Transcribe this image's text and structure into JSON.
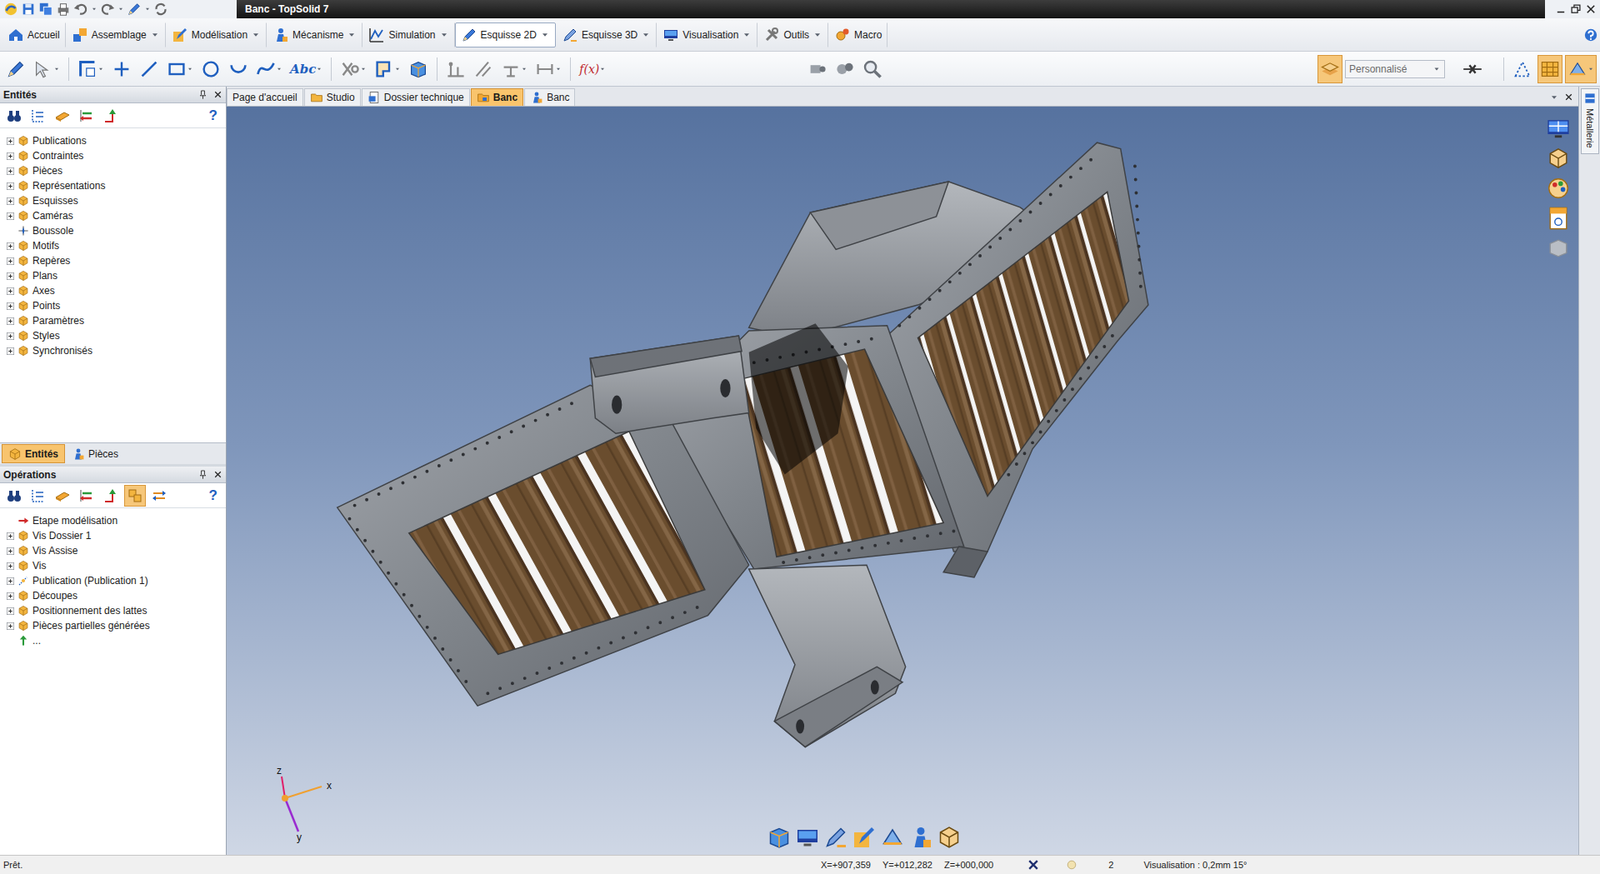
{
  "window": {
    "title": "Banc - TopSolid 7"
  },
  "ribbon_tabs": [
    {
      "label": "Accueil",
      "selected": false
    },
    {
      "label": "Assemblage",
      "selected": false
    },
    {
      "label": "Modélisation",
      "selected": false
    },
    {
      "label": "Mécanisme",
      "selected": false
    },
    {
      "label": "Simulation",
      "selected": false
    },
    {
      "label": "Esquisse 2D",
      "selected": true
    },
    {
      "label": "Esquisse 3D",
      "selected": false
    },
    {
      "label": "Visualisation",
      "selected": false
    },
    {
      "label": "Outils",
      "selected": false
    },
    {
      "label": "Macro",
      "selected": false
    }
  ],
  "toolbar": {
    "text_tool": "Abc",
    "function_tool": "f(x)",
    "style_combo": "Personnalisé",
    "style_button_on": true,
    "view_toggles": [
      {
        "on": false
      },
      {
        "on": true
      },
      {
        "on": true
      }
    ]
  },
  "entities_panel": {
    "title": "Entités",
    "help": "?",
    "items": [
      {
        "label": "Publications",
        "kind": "group",
        "expanded": false
      },
      {
        "label": "Contraintes",
        "kind": "group",
        "expanded": false
      },
      {
        "label": "Pièces",
        "kind": "group",
        "expanded": false
      },
      {
        "label": "Représentations",
        "kind": "group",
        "expanded": false
      },
      {
        "label": "Esquisses",
        "kind": "group",
        "expanded": false
      },
      {
        "label": "Caméras",
        "kind": "group",
        "expanded": false
      },
      {
        "label": "Boussole",
        "kind": "leaf"
      },
      {
        "label": "Motifs",
        "kind": "group",
        "expanded": false
      },
      {
        "label": "Repères",
        "kind": "group",
        "expanded": false
      },
      {
        "label": "Plans",
        "kind": "group",
        "expanded": false
      },
      {
        "label": "Axes",
        "kind": "group",
        "expanded": false
      },
      {
        "label": "Points",
        "kind": "group",
        "expanded": false
      },
      {
        "label": "Paramètres",
        "kind": "group",
        "expanded": false
      },
      {
        "label": "Styles",
        "kind": "group",
        "expanded": false
      },
      {
        "label": "Synchronisés",
        "kind": "group",
        "expanded": false
      }
    ]
  },
  "panel_tabs": [
    {
      "label": "Entités",
      "selected": true
    },
    {
      "label": "Pièces",
      "selected": false
    }
  ],
  "operations_panel": {
    "title": "Opérations",
    "help": "?",
    "group_toggle_on": true,
    "items": [
      {
        "label": "Etape modélisation",
        "kind": "step"
      },
      {
        "label": "Vis Dossier 1",
        "kind": "group",
        "expanded": false
      },
      {
        "label": "Vis Assise",
        "kind": "group",
        "expanded": false
      },
      {
        "label": "Vis",
        "kind": "group",
        "expanded": false
      },
      {
        "label": "Publication (Publication 1)",
        "kind": "publication",
        "expanded": false
      },
      {
        "label": "Découpes",
        "kind": "group",
        "expanded": false
      },
      {
        "label": "Positionnement des lattes",
        "kind": "group",
        "expanded": false
      },
      {
        "label": "Pièces partielles générées",
        "kind": "group",
        "expanded": false
      },
      {
        "label": "...",
        "kind": "end"
      }
    ]
  },
  "document_tabs": [
    {
      "label": "Page d'accueil",
      "kind": "page",
      "selected": false
    },
    {
      "label": "Studio",
      "kind": "folder",
      "selected": false
    },
    {
      "label": "Dossier technique",
      "kind": "document",
      "selected": false
    },
    {
      "label": "Banc",
      "kind": "part",
      "selected": true
    },
    {
      "label": "Banc",
      "kind": "assembly",
      "selected": false
    }
  ],
  "side_tab": "Métallerie",
  "axes": {
    "z": "z",
    "x": "x",
    "y": "y"
  },
  "status_bar": {
    "message": "Prêt.",
    "x": "X=+907,359",
    "y": "Y=+012,282",
    "z": "Z=+000,000",
    "count": "2",
    "visualisation": "Visualisation : 0,2mm 15°"
  }
}
